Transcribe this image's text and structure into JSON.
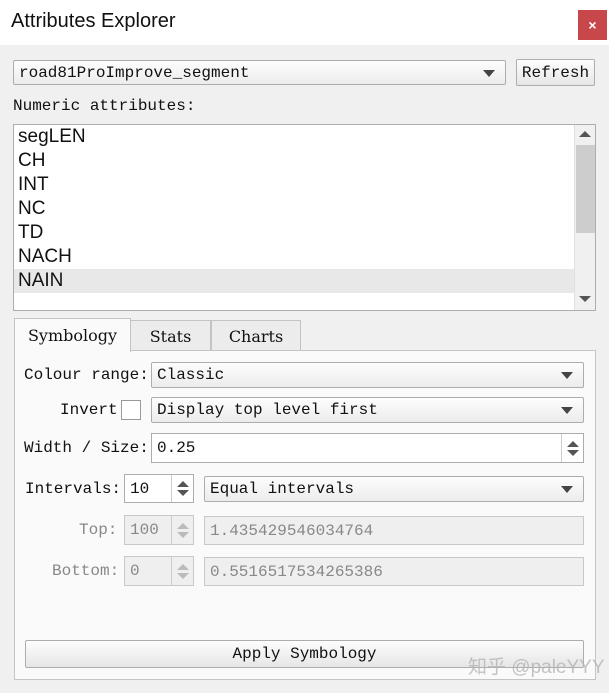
{
  "window": {
    "title": "Attributes Explorer",
    "close": "×"
  },
  "layer_select": {
    "value": "road81ProImprove_segment"
  },
  "refresh_label": "Refresh",
  "numeric_label": "Numeric attributes:",
  "attributes": [
    "segLEN",
    "CH",
    "INT",
    "NC",
    "TD",
    "NACH",
    "NAIN"
  ],
  "selected_attribute": "NAIN",
  "tabs": [
    "Symbology",
    "Stats",
    "Charts"
  ],
  "symbology": {
    "colour_range_label": "Colour range:",
    "colour_range": "Classic",
    "invert_label": "Invert",
    "display_order": "Display top level first",
    "width_label": "Width / Size:",
    "width": "0.25",
    "intervals_label": "Intervals:",
    "intervals": "10",
    "interval_mode": "Equal intervals",
    "top_label": "Top:",
    "top_pct": "100",
    "top_value": "1.435429546034764",
    "bottom_label": "Bottom:",
    "bottom_pct": "0",
    "bottom_value": "0.5516517534265386",
    "apply_label": "Apply Symbology"
  },
  "watermark": "知乎 @paleYYY"
}
